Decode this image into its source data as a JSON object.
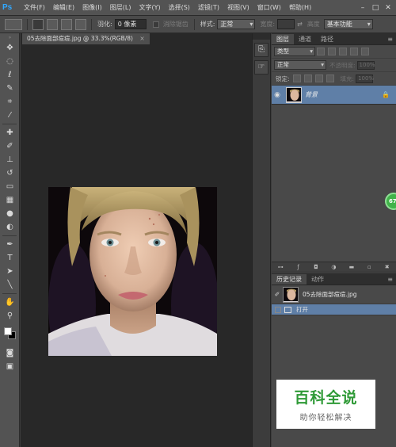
{
  "app": {
    "logo": "Ps"
  },
  "menu": [
    "文件(F)",
    "编辑(E)",
    "图像(I)",
    "图层(L)",
    "文字(Y)",
    "选择(S)",
    "滤镜(T)",
    "视图(V)",
    "窗口(W)",
    "帮助(H)"
  ],
  "window_controls": [
    "–",
    "□",
    "✕"
  ],
  "options_bar": {
    "feather_label": "羽化:",
    "feather_value": "0 像素",
    "antialias_label": "消除锯齿",
    "style_label": "样式:",
    "style_value": "正常",
    "width_label": "宽度:",
    "height_label": "高度",
    "workspace_value": "基本功能"
  },
  "document": {
    "tab_title": "05去除面部痘痘.jpg @ 33.3%(RGB/8)",
    "close": "×"
  },
  "layers_panel": {
    "tabs": [
      "图层",
      "通道",
      "路径"
    ],
    "filter_value": "类型",
    "blend_mode": "正常",
    "opacity_label": "不透明度:",
    "opacity_value": "100%",
    "lock_label": "锁定:",
    "fill_label": "填充:",
    "fill_value": "100%",
    "layers": [
      {
        "name": "背景",
        "visible": true,
        "locked": true,
        "selected": true
      }
    ]
  },
  "history_panel": {
    "tabs": [
      "历史记录",
      "动作"
    ],
    "snapshot_name": "05去除面部痘痘.jpg",
    "states": [
      "打开"
    ]
  },
  "badge": {
    "text": "67"
  },
  "watermark": {
    "title": "百科全说",
    "subtitle": "助你轻松解决"
  },
  "colors": {
    "accent_blue": "#31a8ff",
    "selection_blue": "#5f7fa7",
    "watermark_green": "#2f9a37"
  }
}
